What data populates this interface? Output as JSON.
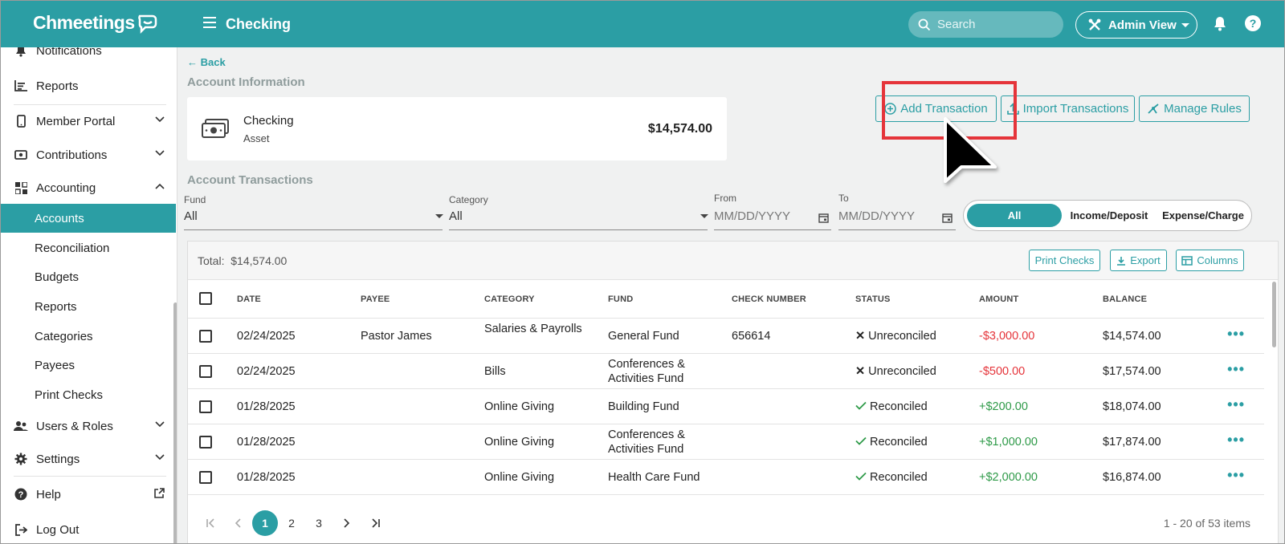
{
  "app": {
    "name": "Chmeetings",
    "page_title": "Checking"
  },
  "topbar": {
    "search_placeholder": "Search",
    "admin_view_label": "Admin View",
    "help_label": "?"
  },
  "sidebar": {
    "items": [
      {
        "label": "Notifications",
        "icon": "bell-icon"
      },
      {
        "label": "Reports",
        "icon": "reports-icon"
      },
      {
        "label": "Member Portal",
        "icon": "phone-icon",
        "expandable": true
      },
      {
        "label": "Contributions",
        "icon": "cash-icon",
        "expandable": true
      },
      {
        "label": "Accounting",
        "icon": "grid-icon",
        "expanded": true
      }
    ],
    "accounting_sub": [
      "Accounts",
      "Reconciliation",
      "Budgets",
      "Reports",
      "Categories",
      "Payees",
      "Print Checks"
    ],
    "active_sub": "Accounts",
    "bottom_items": [
      {
        "label": "Users & Roles",
        "icon": "users-icon"
      },
      {
        "label": "Settings",
        "icon": "gear-icon"
      },
      {
        "label": "Help",
        "icon": "help-icon"
      },
      {
        "label": "Log Out",
        "icon": "logout-icon"
      }
    ]
  },
  "main": {
    "back_label": "Back",
    "account_info_label": "Account Information",
    "account": {
      "name": "Checking",
      "type": "Asset",
      "balance": "$14,574.00"
    },
    "actions": {
      "add_transaction": "Add Transaction",
      "import_transactions": "Import Transactions",
      "manage_rules": "Manage Rules"
    },
    "transactions_label": "Account Transactions",
    "filters": {
      "fund_label": "Fund",
      "fund_value": "All",
      "category_label": "Category",
      "category_value": "All",
      "from_label": "From",
      "from_placeholder": "MM/DD/YYYY",
      "to_label": "To",
      "to_placeholder": "MM/DD/YYYY",
      "type_options": [
        "All",
        "Income/Deposit",
        "Expense/Charge"
      ],
      "type_selected": "All"
    },
    "table": {
      "total_label": "Total:",
      "total_value": "$14,574.00",
      "toolbar": {
        "print_checks": "Print Checks",
        "export": "Export",
        "columns": "Columns"
      },
      "columns": [
        "DATE",
        "PAYEE",
        "CATEGORY",
        "FUND",
        "CHECK NUMBER",
        "STATUS",
        "AMOUNT",
        "BALANCE"
      ],
      "rows": [
        {
          "date": "02/24/2025",
          "payee": "Pastor James",
          "category": "Salaries & Payrolls",
          "fund": "General Fund",
          "check_number": "656614",
          "status": "Unreconciled",
          "amount": "-$3,000.00",
          "balance": "$14,574.00"
        },
        {
          "date": "02/24/2025",
          "payee": "",
          "category": "Bills",
          "fund": "Conferences & Activities Fund",
          "check_number": "",
          "status": "Unreconciled",
          "amount": "-$500.00",
          "balance": "$17,574.00"
        },
        {
          "date": "01/28/2025",
          "payee": "",
          "category": "Online Giving",
          "fund": "Building Fund",
          "check_number": "",
          "status": "Reconciled",
          "amount": "+$200.00",
          "balance": "$18,074.00"
        },
        {
          "date": "01/28/2025",
          "payee": "",
          "category": "Online Giving",
          "fund": "Conferences & Activities Fund",
          "check_number": "",
          "status": "Reconciled",
          "amount": "+$1,000.00",
          "balance": "$17,874.00"
        },
        {
          "date": "01/28/2025",
          "payee": "",
          "category": "Online Giving",
          "fund": "Health Care Fund",
          "check_number": "",
          "status": "Reconciled",
          "amount": "+$2,000.00",
          "balance": "$16,874.00"
        }
      ]
    },
    "pagination": {
      "pages": [
        "1",
        "2",
        "3"
      ],
      "current": "1",
      "info": "1 - 20 of 53 items"
    }
  },
  "colors": {
    "primary": "#2b9ea4",
    "negative": "#e5343a",
    "positive": "#2e9a48",
    "highlight": "#e5343a"
  }
}
